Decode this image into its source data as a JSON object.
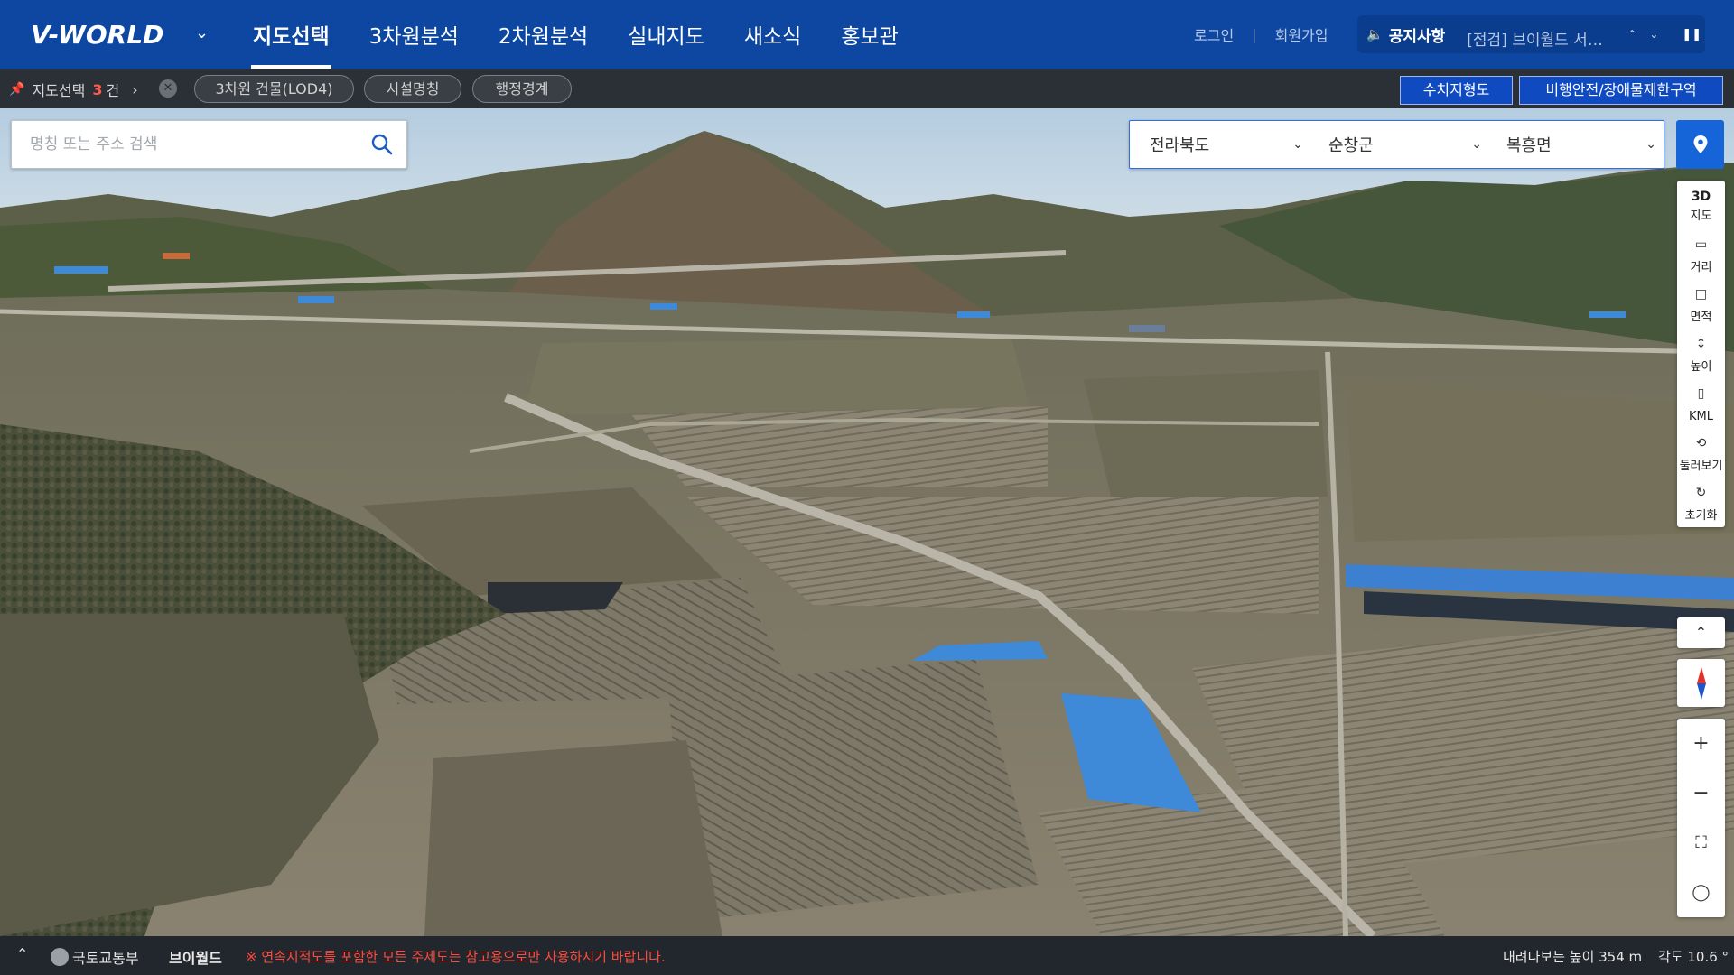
{
  "header": {
    "logo": "V-WORLD",
    "nav": [
      "지도선택",
      "3차원분석",
      "2차원분석",
      "실내지도",
      "새소식",
      "홍보관"
    ],
    "login": "로그인",
    "signup": "회원가입",
    "notice_label": "공지사항",
    "notice_text": "[점검] 브이월드 서비스 점검 안내"
  },
  "subbar": {
    "selected_label": "지도선택",
    "selected_count": "3",
    "selected_unit": "건",
    "chips": [
      "3차원 건물(LOD4)",
      "시설명칭",
      "행정경계"
    ],
    "right_buttons": [
      "수치지형도",
      "비행안전/장애물제한구역"
    ]
  },
  "search": {
    "placeholder": "명칭 또는 주소 검색"
  },
  "region": {
    "province": "전라북도",
    "county": "순창군",
    "town": "복흥면"
  },
  "tools": [
    {
      "line1": "3D",
      "line2": "지도"
    },
    {
      "label": "거리"
    },
    {
      "label": "면적"
    },
    {
      "label": "높이"
    },
    {
      "label": "KML"
    },
    {
      "label": "둘러보기"
    },
    {
      "label": "초기화"
    }
  ],
  "footer": {
    "ministry": "국토교통부",
    "brand": "브이월드",
    "warning": "※ 연속지적도를 포함한 모든 주제도는 참고용으로만 사용하시기 바랍니다.",
    "altitude": "내려다보는 높이 354 m",
    "angle": "각도 10.6 °"
  },
  "colors": {
    "header_bg": "#0d47a1",
    "subbar_bg": "#2b3036",
    "accent": "#1565d8",
    "warning": "#ff4a3d",
    "count": "#ff5a4e"
  }
}
